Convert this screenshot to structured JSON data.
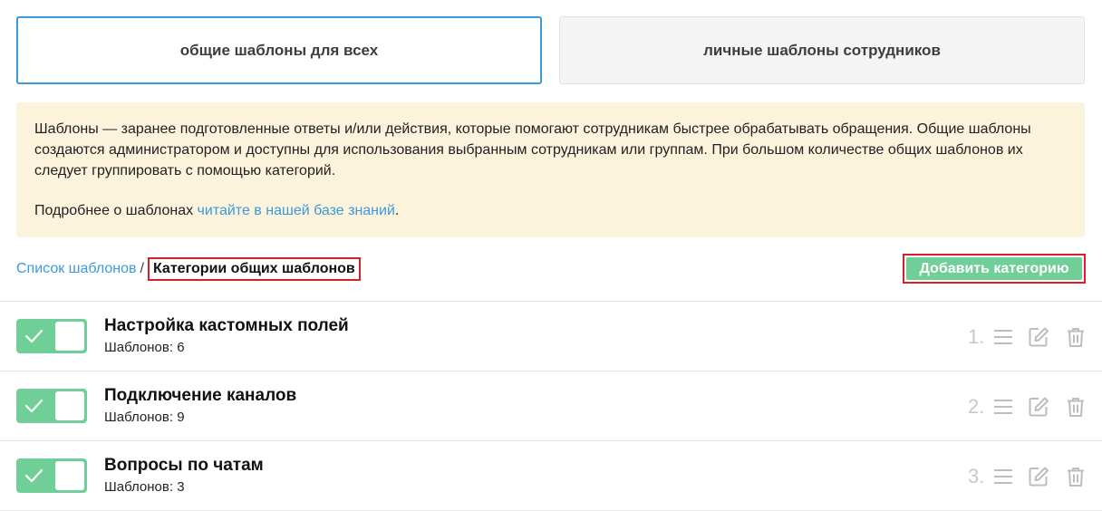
{
  "tabs": {
    "general": "общие шаблоны для всех",
    "personal": "личные шаблоны сотрудников"
  },
  "info": {
    "text": "Шаблоны — заранее подготовленные ответы и/или действия, которые помогают сотрудникам быстрее обрабатывать обращения. Общие шаблоны создаются администратором и доступны для использования выбранным сотрудникам или группам. При большом количестве общих шаблонов их следует группировать с помощью категорий.",
    "more_prefix": "Подробнее о шаблонах ",
    "more_link": "читайте в нашей базе знаний",
    "more_suffix": "."
  },
  "breadcrumb": {
    "link": "Список шаблонов",
    "separator": "/",
    "current": "Категории общих шаблонов"
  },
  "add_button": "Добавить категорию",
  "categories": [
    {
      "title": "Настройка кастомных полей",
      "count": "Шаблонов: 6",
      "num": "1.",
      "enabled": true
    },
    {
      "title": "Подключение каналов",
      "count": "Шаблонов: 9",
      "num": "2.",
      "enabled": true
    },
    {
      "title": "Вопросы по чатам",
      "count": "Шаблонов: 3",
      "num": "3.",
      "enabled": true
    }
  ],
  "colors": {
    "accent_blue": "#3b9ad9",
    "toggle_green": "#6fcf97",
    "info_bg": "#fbf3dc",
    "highlight_red": "#d81e2a"
  },
  "icons": {
    "toggle": "check-icon",
    "reorder": "menu-icon",
    "edit": "edit-icon",
    "delete": "trash-icon"
  }
}
